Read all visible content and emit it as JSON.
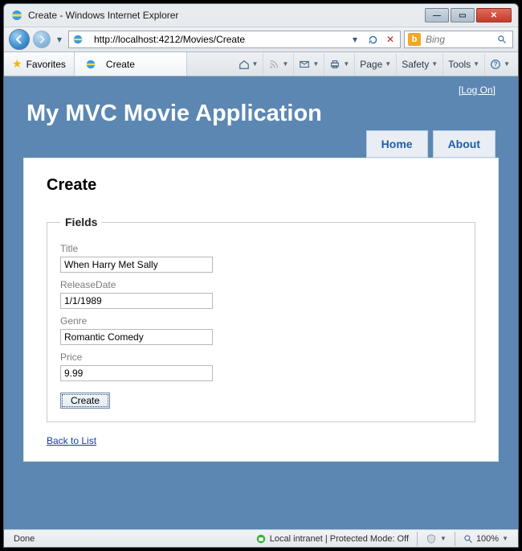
{
  "window": {
    "title": "Create - Windows Internet Explorer",
    "url_display": "http://localhost:4212/Movies/Create",
    "search_placeholder": "Bing"
  },
  "favorites": {
    "label": "Favorites"
  },
  "tab": {
    "title": "Create"
  },
  "commandbar": {
    "page": "Page",
    "safety": "Safety",
    "tools": "Tools"
  },
  "mvc": {
    "logon": "Log On",
    "app_title": "My MVC Movie Application",
    "menu": {
      "home": "Home",
      "about": "About"
    },
    "heading": "Create",
    "legend": "Fields",
    "labels": {
      "title": "Title",
      "releaseDate": "ReleaseDate",
      "genre": "Genre",
      "price": "Price"
    },
    "values": {
      "title": "When Harry Met Sally",
      "releaseDate": "1/1/1989",
      "genre": "Romantic Comedy",
      "price": "9.99"
    },
    "create_btn": "Create",
    "back_link": "Back to List"
  },
  "status": {
    "left": "Done",
    "zone": "Local intranet | Protected Mode: Off",
    "zoom": "100%"
  }
}
